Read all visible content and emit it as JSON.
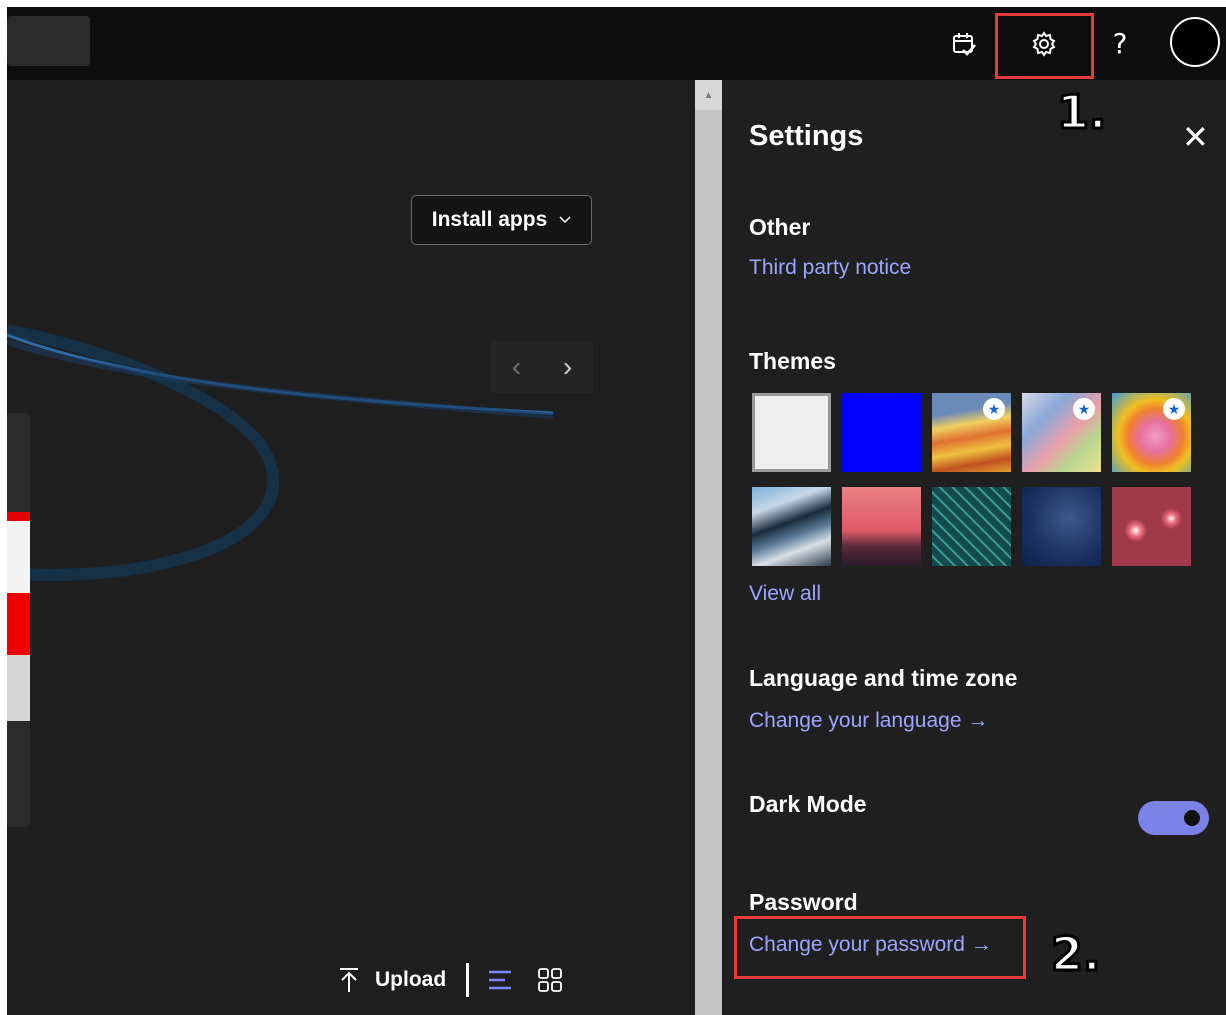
{
  "topbar": {
    "icons": [
      "calendar-check-icon",
      "gear-icon",
      "help-icon",
      "avatar"
    ],
    "help_label": "?"
  },
  "main": {
    "install_apps_label": "Install apps",
    "prev_arrow": "‹",
    "next_arrow": "›",
    "upload_label": "Upload"
  },
  "settings": {
    "title": "Settings",
    "close_label": "✕",
    "other_heading": "Other",
    "third_party_link": "Third party notice",
    "themes_heading": "Themes",
    "themes": [
      {
        "name": "light",
        "color": "#f0f0f0",
        "starred": false
      },
      {
        "name": "blue",
        "color": "#0000ff",
        "starred": false
      },
      {
        "name": "rainbow-waves",
        "color": "#e0b040",
        "starred": true
      },
      {
        "name": "pastel-feathers",
        "color": "#b8c8e8",
        "starred": true
      },
      {
        "name": "unicorn",
        "color": "#ff9a3a",
        "starred": true
      },
      {
        "name": "mountain",
        "color": "#4a6a8a",
        "starred": false
      },
      {
        "name": "palm-sunset",
        "color": "#e05a5a",
        "starred": false
      },
      {
        "name": "circuit",
        "color": "#1f6a6a",
        "starred": false
      },
      {
        "name": "innovation",
        "color": "#1f3a6a",
        "starred": false
      },
      {
        "name": "bokeh",
        "color": "#c04a5a",
        "starred": false
      }
    ],
    "view_all_link": "View all",
    "language_heading": "Language and time zone",
    "change_language_link": "Change your language →",
    "dark_mode_label": "Dark Mode",
    "dark_mode_on": true,
    "password_heading": "Password",
    "change_password_link": "Change your password →"
  },
  "annotations": {
    "step1": "1.",
    "step2": "2."
  },
  "colors": {
    "highlight": "#e83a3a",
    "link": "#9ba6ff",
    "toggle": "#7b83e6"
  }
}
